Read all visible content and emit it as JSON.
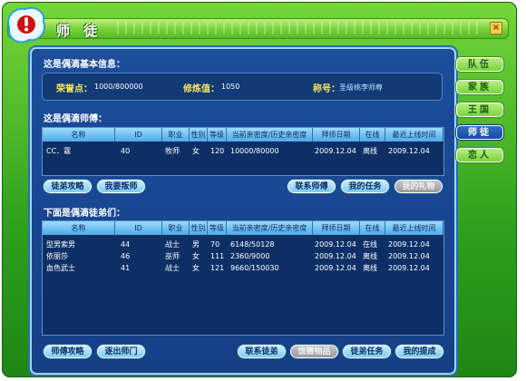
{
  "window": {
    "title": "师 徒",
    "close_glyph": "×"
  },
  "tabs": [
    {
      "label": "队伍"
    },
    {
      "label": "家族"
    },
    {
      "label": "王国"
    },
    {
      "label": "师徒",
      "active": true
    },
    {
      "label": "恋人"
    }
  ],
  "basic_info": {
    "heading": "这是偶滴基本信息：",
    "honor_label": "荣誉点：",
    "honor_value": "1000/800000",
    "cultivation_label": "修炼值：",
    "cultivation_value": "1050",
    "title_label": "称号：",
    "title_value": "圣级桃李师尊"
  },
  "master": {
    "heading": "这是偶滴师傅：",
    "columns": [
      "名称",
      "ID",
      "职业",
      "性别",
      "等级",
      "当前亲密度/历史亲密度",
      "拜师日期",
      "在线",
      "最近上线时间"
    ],
    "rows": [
      [
        "CC．霆",
        "40",
        "牧师",
        "女",
        "120",
        "10000/80000",
        "2009.12.04",
        "离线",
        "2009.12.04"
      ]
    ]
  },
  "master_buttons": {
    "strategy": "徒弟攻略",
    "betray": "我要叛师",
    "contact": "联系师傅",
    "tasks": "我的任务",
    "gifts": "我的礼物"
  },
  "disciples": {
    "heading": "下面是偶滴徒弟们：",
    "columns": [
      "名称",
      "ID",
      "职业",
      "性别",
      "等级",
      "当前亲密度/历史亲密度",
      "拜师日期",
      "在线",
      "最近上线时间"
    ],
    "rows": [
      [
        "型男索男",
        "44",
        "战士",
        "男",
        "70",
        "6148/50128",
        "2009.12.04",
        "在线",
        "2009.12.04"
      ],
      [
        "依丽莎",
        "46",
        "巫师",
        "女",
        "111",
        "2360/9000",
        "2009.12.04",
        "离线",
        "2009.12.04"
      ],
      [
        "血色武士",
        "41",
        "战士",
        "女",
        "121",
        "9660/150030",
        "2009.12.04",
        "离线",
        "2009.12.04"
      ]
    ]
  },
  "disciple_buttons": {
    "strategy": "师傅攻略",
    "expel": "逐出师门",
    "contact": "联系徒弟",
    "gift": "馈赠物品",
    "tasks": "徒弟任务",
    "promote": "我的提成"
  },
  "colors": {
    "frame": "#3aa826",
    "panel": "#1a4a96",
    "header": "#7cc6f2",
    "label": "#f4e65a"
  }
}
